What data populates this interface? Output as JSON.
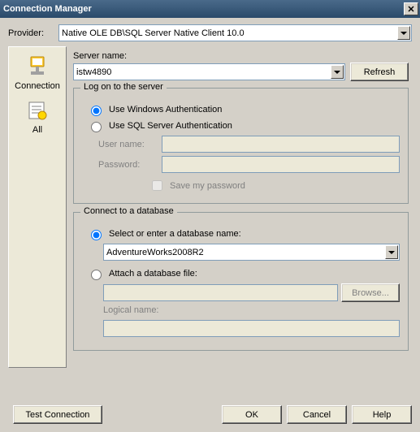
{
  "window": {
    "title": "Connection Manager"
  },
  "provider": {
    "label": "Provider:",
    "value": "Native OLE DB\\SQL Server Native Client 10.0"
  },
  "sidebar": {
    "items": [
      {
        "label": "Connection"
      },
      {
        "label": "All"
      }
    ]
  },
  "server": {
    "label": "Server name:",
    "value": "istw4890",
    "refresh": "Refresh"
  },
  "logon": {
    "legend": "Log on to the server",
    "opt_windows": "Use Windows Authentication",
    "opt_sql": "Use SQL Server Authentication",
    "user_label": "User name:",
    "user_value": "",
    "password_label": "Password:",
    "password_value": "",
    "save_pw": "Save my password"
  },
  "db": {
    "legend": "Connect to a database",
    "opt_select": "Select or enter a database name:",
    "db_value": "AdventureWorks2008R2",
    "opt_attach": "Attach a database file:",
    "attach_value": "",
    "browse": "Browse...",
    "logical_label": "Logical name:",
    "logical_value": ""
  },
  "footer": {
    "test": "Test Connection",
    "ok": "OK",
    "cancel": "Cancel",
    "help": "Help"
  }
}
